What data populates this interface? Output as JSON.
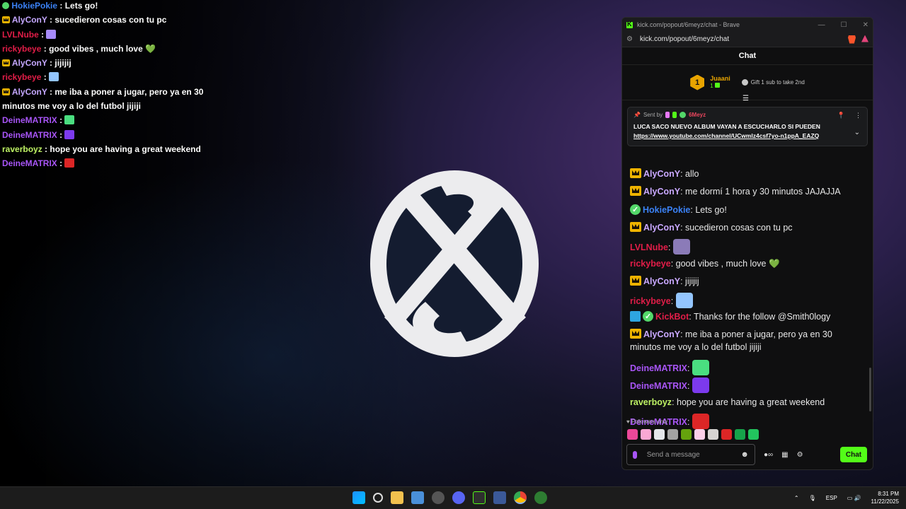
{
  "overlay_chat": [
    {
      "badge": "verified",
      "user": "HokiePokie",
      "color": "#3b82f6",
      "text": "Lets go!"
    },
    {
      "badge": "crown",
      "user": "AlyConY",
      "color": "#c4a7ff",
      "text": "sucedieron cosas con tu pc"
    },
    {
      "badge": "",
      "user": "LVLNube",
      "color": "#e11d48",
      "text": "",
      "emote": "#a78bfa"
    },
    {
      "badge": "",
      "user": "rickybeye",
      "color": "#e11d48",
      "text": "good vibes , much love 💚"
    },
    {
      "badge": "crown",
      "user": "AlyConY",
      "color": "#c4a7ff",
      "text": "jijijij"
    },
    {
      "badge": "",
      "user": "rickybeye",
      "color": "#e11d48",
      "text": "",
      "emote": "#93c5fd"
    },
    {
      "badge": "crown",
      "user": "AlyConY",
      "color": "#c4a7ff",
      "text": "me iba a poner a jugar, pero ya en 30 minutos me voy a lo del futbol jijiji"
    },
    {
      "badge": "",
      "user": "DeineMATRIX",
      "color": "#a855f7",
      "text": "",
      "emote": "#4ade80"
    },
    {
      "badge": "",
      "user": "DeineMATRIX",
      "color": "#a855f7",
      "text": "",
      "emote": "#7c3aed"
    },
    {
      "badge": "",
      "user": "raverboyz",
      "color": "#bef264",
      "text": "hope you are having a great weekend"
    },
    {
      "badge": "",
      "user": "DeineMATRIX",
      "color": "#a855f7",
      "text": "",
      "emote": "#dc2626"
    }
  ],
  "browser": {
    "title": "kick.com/popout/6meyz/chat - Brave",
    "url": "kick.com/popout/6meyz/chat"
  },
  "chat": {
    "header": "Chat",
    "gifter": {
      "rank": "1",
      "name": "Juaani",
      "count": "1",
      "hint": "Gift 1 sub to take 2nd"
    },
    "pinned": {
      "sent_by": "Sent by",
      "sender": "6Meyz",
      "text": "LUCA SACO NUEVO ALBUM VAYAN A ESCUCHARLO SI PUEDEN",
      "link": "https://www.youtube.com/channel/UCwmlz4csf7yo-n1ppA_EAZQ"
    },
    "messages": [
      {
        "badges": [
          "crown"
        ],
        "user": "AlyConY",
        "color": "#c9a8ff",
        "text": "allo"
      },
      {
        "badges": [
          "crown"
        ],
        "user": "AlyConY",
        "color": "#c9a8ff",
        "text": "me dormí 1 hora y 30 minutos JAJAJJA"
      },
      {
        "badges": [
          "verified"
        ],
        "user": "HokiePokie",
        "color": "#3b82f6",
        "text": "Lets go!"
      },
      {
        "badges": [
          "crown"
        ],
        "user": "AlyConY",
        "color": "#c9a8ff",
        "text": "sucedieron cosas con tu pc"
      },
      {
        "badges": [],
        "user": "LVLNube",
        "color": "#e11d48",
        "text": "",
        "emote": "#8b7bb8"
      },
      {
        "badges": [],
        "user": "rickybeye",
        "color": "#e11d48",
        "text": "good vibes , much love 💚"
      },
      {
        "badges": [
          "crown"
        ],
        "user": "AlyConY",
        "color": "#c9a8ff",
        "text": "jijijij"
      },
      {
        "badges": [],
        "user": "rickybeye",
        "color": "#e11d48",
        "text": "",
        "emote": "#93c5fd"
      },
      {
        "badges": [
          "bot",
          "verified"
        ],
        "user": "KickBot",
        "color": "#e11d48",
        "text": "Thanks for the follow @Smith0logy"
      },
      {
        "badges": [
          "crown"
        ],
        "user": "AlyConY",
        "color": "#c9a8ff",
        "text": "me iba a poner a jugar, pero ya en 30 minutos me voy a lo del futbol jijiji"
      },
      {
        "badges": [],
        "user": "DeineMATRIX",
        "color": "#a855f7",
        "text": "",
        "emote": "#4ade80"
      },
      {
        "badges": [],
        "user": "DeineMATRIX",
        "color": "#a855f7",
        "text": "",
        "emote": "#7c3aed"
      },
      {
        "badges": [],
        "user": "raverboyz",
        "color": "#bef264",
        "text": "hope you are having a great weekend"
      },
      {
        "badges": [],
        "user": "DeineMATRIX",
        "color": "#a855f7",
        "text": "",
        "emote": "#dc2626"
      }
    ],
    "followers_only": "Followers only",
    "input_placeholder": "Send a message",
    "send_label": "Chat"
  },
  "taskbar": {
    "lang": "ESP",
    "time": "8:31 PM",
    "date": "11/22/2025"
  },
  "colors": {
    "kick_green": "#53fc18",
    "crown": "#f0b400"
  }
}
